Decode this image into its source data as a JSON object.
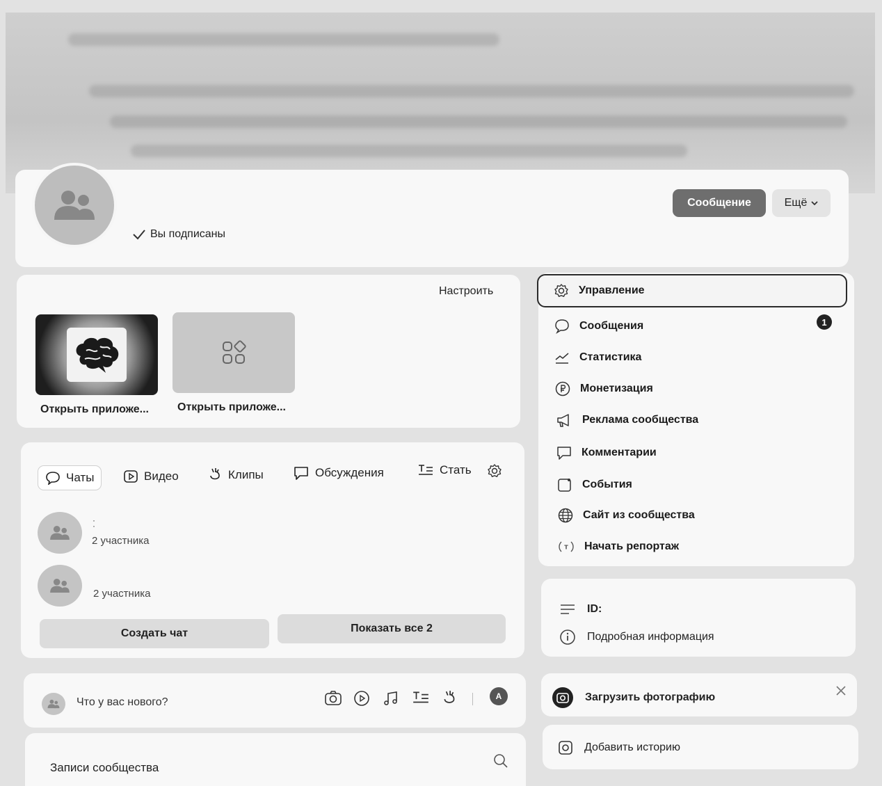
{
  "header": {
    "subscribed_label": "Вы подписаны",
    "message_button": "Сообщение",
    "more_button": "Ещё"
  },
  "apps": {
    "customize_label": "Настроить",
    "items": [
      {
        "label": "Открыть приложе...",
        "icon": "brain-icon"
      },
      {
        "label": "Открыть приложе...",
        "icon": "apps-grid-icon"
      }
    ]
  },
  "tabs": [
    {
      "label": "Чаты",
      "icon": "chat-icon",
      "active": true
    },
    {
      "label": "Видео",
      "icon": "video-icon"
    },
    {
      "label": "Клипы",
      "icon": "clips-icon"
    },
    {
      "label": "Обсуждения",
      "icon": "discussion-icon"
    },
    {
      "label": "Стать",
      "icon": "article-icon"
    }
  ],
  "chats": {
    "items": [
      {
        "members": "2 участника"
      },
      {
        "members": "2 участника"
      }
    ],
    "create_button": "Создать чат",
    "show_all_button": "Показать все 2"
  },
  "composer": {
    "placeholder": "Что у вас нового?",
    "avatar_letter": "A"
  },
  "wall": {
    "title": "Записи сообщества"
  },
  "menu": {
    "items": [
      {
        "label": "Управление",
        "icon": "gear-icon"
      },
      {
        "label": "Сообщения",
        "icon": "message-icon",
        "badge": "1"
      },
      {
        "label": "Статистика",
        "icon": "stats-icon"
      },
      {
        "label": "Монетизация",
        "icon": "ruble-icon"
      },
      {
        "label": "Реклама сообщества",
        "icon": "megaphone-icon"
      },
      {
        "label": "Комментарии",
        "icon": "comment-icon"
      },
      {
        "label": "События",
        "icon": "event-icon"
      },
      {
        "label": "Сайт из сообщества",
        "icon": "globe-icon"
      },
      {
        "label": "Начать репортаж",
        "icon": "broadcast-icon"
      }
    ]
  },
  "info": {
    "id_label": "ID:",
    "details_label": "Подробная информация"
  },
  "upload": {
    "label": "Загрузить фотографию"
  },
  "story": {
    "label": "Добавить историю"
  },
  "colors": {
    "page_bg": "#e2e2e2",
    "card_bg": "#f8f8f8",
    "primary_button": "#6e6e6e"
  }
}
